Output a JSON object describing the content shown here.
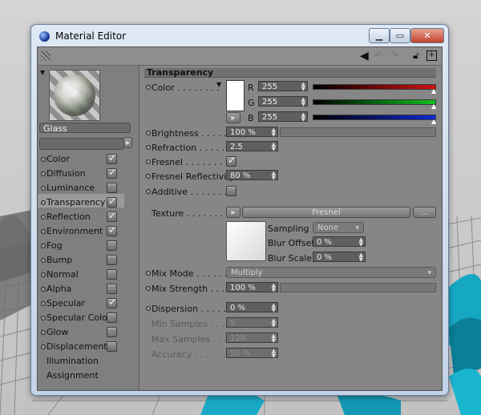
{
  "window": {
    "title": "Material Editor"
  },
  "preview": {
    "material_name": "Glass"
  },
  "channels": [
    {
      "label": "Color",
      "checked": true,
      "active": false
    },
    {
      "label": "Diffusion",
      "checked": true,
      "active": false
    },
    {
      "label": "Luminance",
      "checked": false,
      "active": false
    },
    {
      "label": "Transparency",
      "checked": true,
      "active": true
    },
    {
      "label": "Reflection",
      "checked": true,
      "active": false
    },
    {
      "label": "Environment",
      "checked": true,
      "active": false
    },
    {
      "label": "Fog",
      "checked": false,
      "active": false
    },
    {
      "label": "Bump",
      "checked": false,
      "active": false
    },
    {
      "label": "Normal",
      "checked": false,
      "active": false
    },
    {
      "label": "Alpha",
      "checked": false,
      "active": false
    },
    {
      "label": "Specular",
      "checked": true,
      "active": false
    },
    {
      "label": "Specular Color",
      "checked": false,
      "active": false
    },
    {
      "label": "Glow",
      "checked": false,
      "active": false
    },
    {
      "label": "Displacement",
      "checked": false,
      "active": false
    }
  ],
  "extra_items": [
    "Illumination",
    "Assignment"
  ],
  "section": {
    "title": "Transparency"
  },
  "color": {
    "label": "Color",
    "r_label": "R",
    "g_label": "G",
    "b_label": "B",
    "r": "255",
    "g": "255",
    "b": "255",
    "swatch": "#ffffff"
  },
  "brightness": {
    "label": "Brightness",
    "value": "100 %",
    "fraction": 1.0
  },
  "refraction": {
    "label": "Refraction",
    "value": "2.5"
  },
  "fresnel": {
    "label": "Fresnel",
    "checked": true
  },
  "fresnel_reflectivity": {
    "label": "Fresnel Reflectivity",
    "value": "80 %"
  },
  "additive": {
    "label": "Additive",
    "checked": false
  },
  "texture": {
    "label": "Texture",
    "shader": "Fresnel",
    "more": "...",
    "sampling_label": "Sampling",
    "sampling": "None",
    "blur_offset_label": "Blur Offset",
    "blur_offset": "0 %",
    "blur_scale_label": "Blur Scale",
    "blur_scale": "0 %"
  },
  "mix_mode": {
    "label": "Mix Mode",
    "value": "Multiply"
  },
  "mix_strength": {
    "label": "Mix Strength",
    "value": "100 %",
    "fraction": 1.0
  },
  "dispersion": {
    "label": "Dispersion",
    "value": "0 %"
  },
  "min_samples": {
    "label": "Min Samples",
    "value": "5"
  },
  "max_samples": {
    "label": "Max Samples",
    "value": "128"
  },
  "accuracy": {
    "label": "Accuracy",
    "value": "50 %"
  },
  "colors": {
    "red_bar": "#d01010",
    "green_bar": "#10c020",
    "blue_bar": "#1028d0",
    "highlight": "#9a9a9a"
  }
}
